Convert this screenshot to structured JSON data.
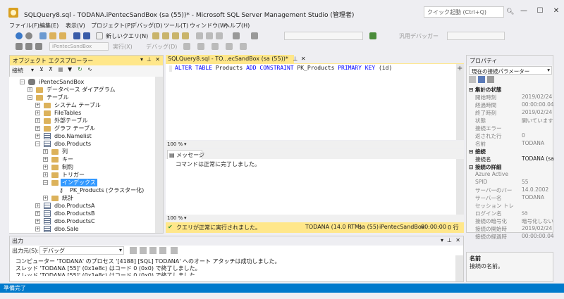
{
  "window": {
    "title": "SQLQuery8.sql - TODANA.iPentecSandBox (sa (55))* - Microsoft SQL Server Management Studio (管理者)",
    "quick_launch_placeholder": "クイック起動 (Ctrl+Q)",
    "minimize": "—",
    "maximize": "☐",
    "close": "✕"
  },
  "menu": [
    "ファイル(F)",
    "編集(E)",
    "表示(V)",
    "プロジェクト(P)",
    "デバッグ(D)",
    "ツール(T)",
    "ウィンドウ(W)",
    "ヘルプ(H)"
  ],
  "toolbar1": {
    "new_query": "新しいクエリ(N)",
    "debugger": "汎用デバッガー"
  },
  "toolbar2": {
    "database": "iPentecSandBox",
    "execute": "実行(X)",
    "debug": "デバッグ(D)"
  },
  "object_explorer": {
    "title": "オブジェクト エクスプローラー",
    "connect": "接続",
    "tree": [
      {
        "label": "iPentecSandBox",
        "level": 0,
        "expander": "−",
        "icon": "db"
      },
      {
        "label": "データベース ダイアグラム",
        "level": 1,
        "expander": "+",
        "icon": "folder"
      },
      {
        "label": "テーブル",
        "level": 1,
        "expander": "−",
        "icon": "folder"
      },
      {
        "label": "システム テーブル",
        "level": 2,
        "expander": "+",
        "icon": "folder"
      },
      {
        "label": "FileTables",
        "level": 2,
        "expander": "+",
        "icon": "folder"
      },
      {
        "label": "外部テーブル",
        "level": 2,
        "expander": "+",
        "icon": "folder"
      },
      {
        "label": "グラフ テーブル",
        "level": 2,
        "expander": "+",
        "icon": "folder"
      },
      {
        "label": "dbo.Namelist",
        "level": 2,
        "expander": "+",
        "icon": "table"
      },
      {
        "label": "dbo.Products",
        "level": 2,
        "expander": "−",
        "icon": "table"
      },
      {
        "label": "列",
        "level": 3,
        "expander": "+",
        "icon": "folder"
      },
      {
        "label": "キー",
        "level": 3,
        "expander": "+",
        "icon": "folder"
      },
      {
        "label": "制約",
        "level": 3,
        "expander": "+",
        "icon": "folder"
      },
      {
        "label": "トリガー",
        "level": 3,
        "expander": "+",
        "icon": "folder"
      },
      {
        "label": "インデックス",
        "level": 3,
        "expander": "−",
        "icon": "folder",
        "selected": true
      },
      {
        "label": "PK_Products (クラスター化)",
        "level": 4,
        "expander": "",
        "icon": "key"
      },
      {
        "label": "統計",
        "level": 3,
        "expander": "+",
        "icon": "folder"
      },
      {
        "label": "dbo.ProductsA",
        "level": 2,
        "expander": "+",
        "icon": "table"
      },
      {
        "label": "dbo.ProductsB",
        "level": 2,
        "expander": "+",
        "icon": "table"
      },
      {
        "label": "dbo.ProductsC",
        "level": 2,
        "expander": "+",
        "icon": "table"
      },
      {
        "label": "dbo.Sale",
        "level": 2,
        "expander": "+",
        "icon": "table"
      }
    ]
  },
  "editor": {
    "tab": "SQLQuery8.sql - TO...ecSandBox (sa (55))*",
    "tab_close": "✕",
    "code": {
      "kw1": "ALTER TABLE",
      "t1": " Products ",
      "kw2": "ADD CONSTRAINT",
      "t2": " PK_Products ",
      "kw3": "PRIMARY KEY",
      "t3": " (id)"
    },
    "zoom": "100 %",
    "messages_tab": "メッセージ",
    "message": "コマンドは正常に完了しました。",
    "zoom2": "100 %",
    "status_text": "クエリが正常に実行されました。",
    "server": "TODANA (14.0 RTM)",
    "user": "sa (55)",
    "db": "iPentecSandBox",
    "time": "00:00:00",
    "rows": "0 行"
  },
  "properties": {
    "title": "プロパティ",
    "combo": "現在の接続パラメーター",
    "cat1": "集計の状態",
    "cat2": "接続",
    "cat3": "接続の詳細",
    "rows1": [
      {
        "name": "開始時刻",
        "value": "2019/02/24 22:50"
      },
      {
        "name": "経過時間",
        "value": "00:00:00.046"
      },
      {
        "name": "終了時刻",
        "value": "2019/02/24 22:50"
      },
      {
        "name": "状態",
        "value": "開いています"
      },
      {
        "name": "接続エラー",
        "value": ""
      },
      {
        "name": "返された行",
        "value": "0"
      },
      {
        "name": "名前",
        "value": "TODANA"
      }
    ],
    "rows2": [
      {
        "name": "接続名",
        "value": "TODANA (sa)"
      }
    ],
    "rows3": [
      {
        "name": "Azure Active",
        "value": ""
      },
      {
        "name": "SPID",
        "value": "55"
      },
      {
        "name": "サーバーのバー",
        "value": "14.0.2002"
      },
      {
        "name": "サーバー名",
        "value": "TODANA"
      },
      {
        "name": "セッション トレ",
        "value": ""
      },
      {
        "name": "ログイン名",
        "value": "sa"
      },
      {
        "name": "接続の暗号化",
        "value": "暗号化しない"
      },
      {
        "name": "接続の開始時",
        "value": "2019/02/24 22:50"
      },
      {
        "name": "接続の経過時",
        "value": "00:00:00.046"
      }
    ],
    "desc_title": "名前",
    "desc_text": "接続の名前。"
  },
  "output": {
    "title": "出力",
    "source_label": "出力元(S):",
    "source_value": "デバッグ",
    "lines": [
      "コンピューター 'TODANA' のプロセス '[4188] [SQL] TODANA' へのオート アタッチは成功しました。",
      "スレッド 'TODANA [55]' (0x1e8c) はコード 0 (0x0) で終了しました。",
      "スレッド 'TODANA [55]' (0x1e8c) はコード 0 (0x0) で終了しました。"
    ]
  },
  "statusbar": {
    "text": "準備完了"
  },
  "colors": {
    "accent": "#007acc",
    "tab_yellow": "#ffe78a",
    "select": "#3399ff",
    "keyword": "#0000ff"
  }
}
